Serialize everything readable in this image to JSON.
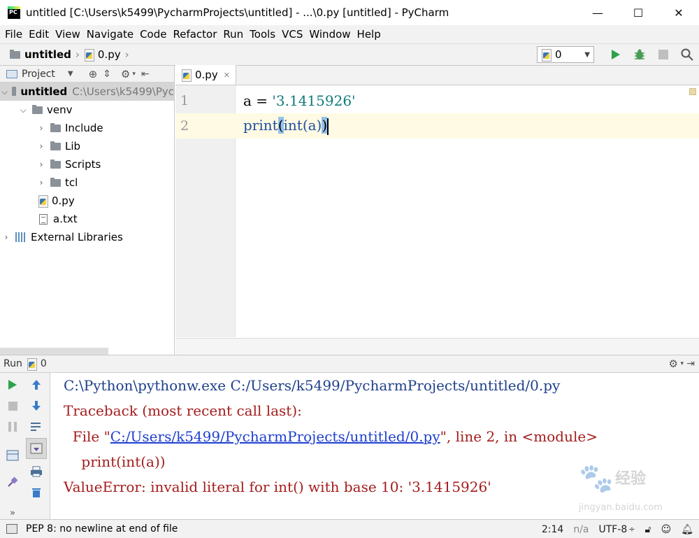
{
  "window": {
    "title": "untitled [C:\\Users\\k5499\\PycharmProjects\\untitled] - ...\\0.py [untitled] - PyCharm",
    "logo_text": "PC",
    "minimize": "—",
    "maximize": "☐",
    "close": "✕"
  },
  "menu": [
    {
      "label": "File"
    },
    {
      "label": "Edit"
    },
    {
      "label": "View"
    },
    {
      "label": "Navigate"
    },
    {
      "label": "Code"
    },
    {
      "label": "Refactor"
    },
    {
      "label": "Run"
    },
    {
      "label": "Tools"
    },
    {
      "label": "VCS"
    },
    {
      "label": "Window"
    },
    {
      "label": "Help"
    }
  ],
  "breadcrumb": {
    "project": "untitled",
    "file": "0.py",
    "separator": "›"
  },
  "run_config": {
    "selected": "0"
  },
  "colors": {
    "run_green": "#2ca24c",
    "debug_green": "#499c54",
    "accent_blue": "#3a77b0"
  },
  "project_panel": {
    "title": "Project",
    "tree": [
      {
        "label": "untitled",
        "path": "C:\\Users\\k5499\\Pyc",
        "icon": "folder-icon"
      },
      {
        "label": "venv",
        "icon": "folder-icon"
      },
      {
        "label": "Include",
        "icon": "folder-icon"
      },
      {
        "label": "Lib",
        "icon": "folder-icon"
      },
      {
        "label": "Scripts",
        "icon": "folder-icon"
      },
      {
        "label": "tcl",
        "icon": "folder-icon"
      },
      {
        "label": "0.py",
        "icon": "python-file-icon"
      },
      {
        "label": "a.txt",
        "icon": "text-file-icon"
      },
      {
        "label": "External Libraries",
        "icon": "library-icon"
      }
    ]
  },
  "editor": {
    "tab": "0.py",
    "lines": [
      {
        "number": "1",
        "code_a": "a = ",
        "code_str": "'3.1415926'"
      },
      {
        "number": "2",
        "fn": "print",
        "open": "(",
        "inner": "int(a)",
        "close": ")"
      }
    ]
  },
  "run_panel": {
    "label": "Run",
    "config": "0",
    "console": [
      "C:\\Python\\pythonw.exe C:/Users/k5499/PycharmProjects/untitled/0.py",
      "Traceback (most recent call last):",
      {
        "prefix": "  File \"",
        "link": "C:/Users/k5499/PycharmProjects/untitled/0.py",
        "suffix": "\", line 2, in <module>"
      },
      "    print(int(a))",
      "ValueError: invalid literal for int() with base 10: '3.1415926'"
    ]
  },
  "status": {
    "message": "PEP 8: no newline at end of file",
    "position": "2:14",
    "line_sep": "n/a",
    "encoding": "UTF-8"
  },
  "watermark": {
    "brand": "经验",
    "url": "jingyan.baidu.com"
  }
}
